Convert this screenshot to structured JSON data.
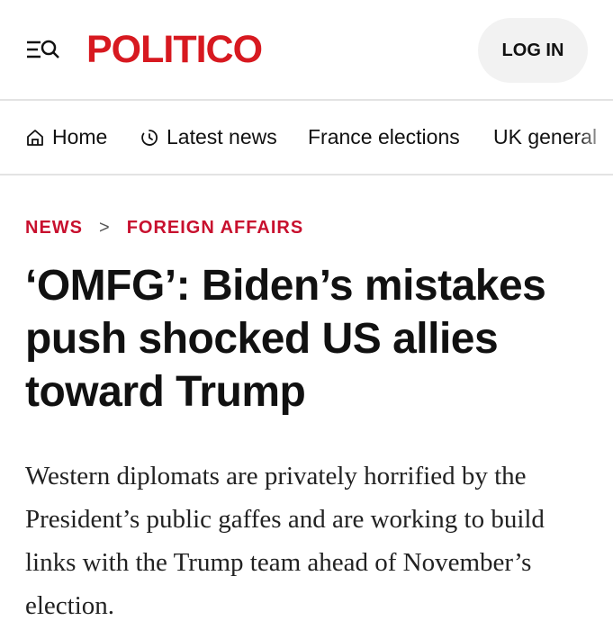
{
  "header": {
    "logo": "POLITICO",
    "login_label": "LOG IN",
    "menu_icon": "menu-search-icon",
    "brand_color": "#d71920"
  },
  "nav": {
    "items": [
      {
        "label": "Home",
        "icon": "home-icon"
      },
      {
        "label": "Latest news",
        "icon": "clock-icon"
      },
      {
        "label": "France elections"
      },
      {
        "label": "UK general"
      }
    ]
  },
  "breadcrumb": {
    "items": [
      "NEWS",
      "FOREIGN AFFAIRS"
    ],
    "separator": ">",
    "color": "#c8102e"
  },
  "article": {
    "headline": "‘OMFG’: Biden’s mistakes push shocked US allies toward Trump",
    "dek": "Western diplomats are privately horrified by the President’s public gaffes and are working to build links with the Trump team ahead of November’s election."
  }
}
